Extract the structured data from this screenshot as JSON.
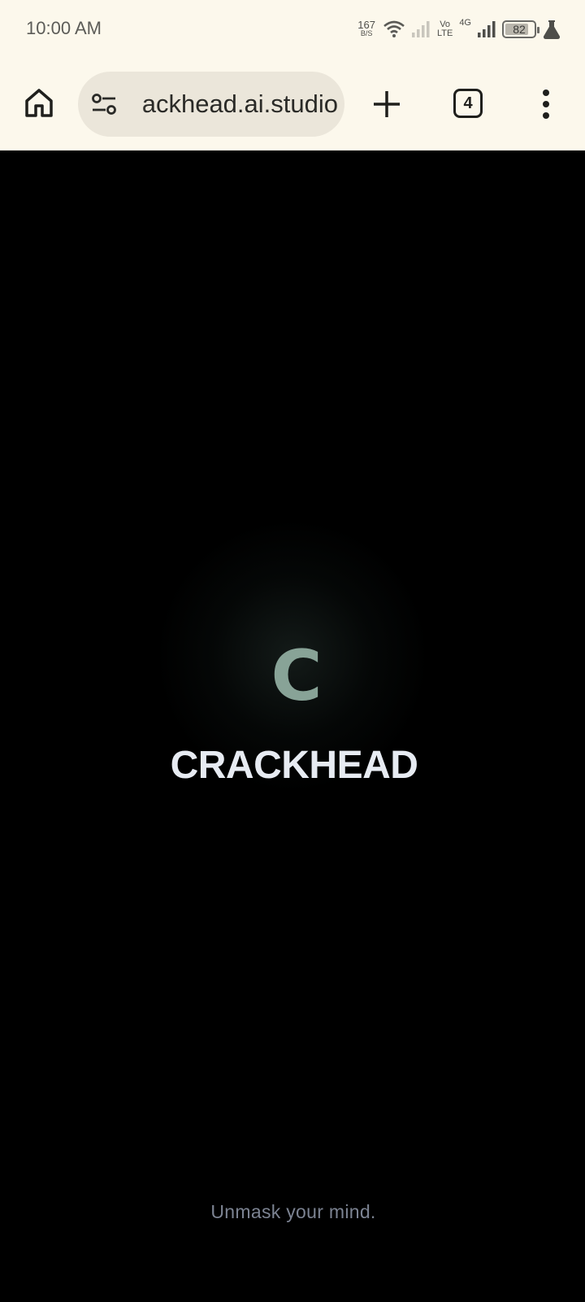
{
  "status_bar": {
    "time": "10:00 AM",
    "net_speed_value": "167",
    "net_speed_unit": "B/S",
    "volte_top": "Vo",
    "volte_bottom": "LTE",
    "network_type": "4G",
    "battery_level": "82",
    "icons": [
      "wifi-icon",
      "signal-weak-icon",
      "signal-icon",
      "battery-icon",
      "flask-icon"
    ]
  },
  "browser": {
    "url": "ackhead.ai.studio",
    "tab_count": "4",
    "icons": [
      "home-icon",
      "tune-icon",
      "plus-icon",
      "more-vert-icon"
    ]
  },
  "page": {
    "logo_letter": "C",
    "brand_name": "CRACKHEAD",
    "tagline": "Unmask your mind."
  },
  "colors": {
    "background": "#000000",
    "chrome": "#fcf8ec",
    "url_pill": "#ebe6da",
    "logo_accent": "#88a397",
    "brand_text": "#e7ebf2",
    "tagline_text": "#7c8392"
  }
}
